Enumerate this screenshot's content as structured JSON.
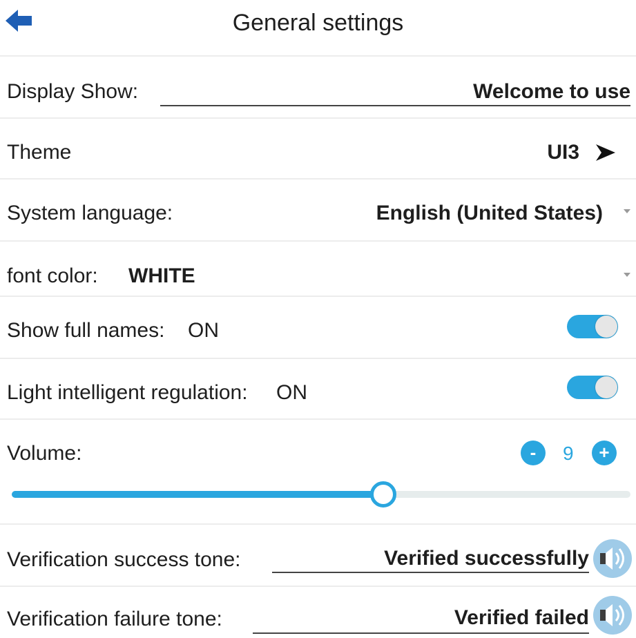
{
  "header": {
    "title": "General settings",
    "back_icon": "arrow-left-icon"
  },
  "display_show": {
    "label": "Display Show:",
    "value": "Welcome to use"
  },
  "theme": {
    "label": "Theme",
    "value": "UI3",
    "icon": "arrow-right-icon"
  },
  "system_language": {
    "label": "System language:",
    "value": "English (United States)"
  },
  "font_color": {
    "label": "font color:",
    "value": "WHITE"
  },
  "show_full_names": {
    "label": "Show full names:",
    "state": "ON",
    "enabled": true
  },
  "light_regulation": {
    "label": "Light intelligent regulation:",
    "state": "ON",
    "enabled": true
  },
  "volume": {
    "label": "Volume:",
    "minus": "-",
    "plus": "+",
    "value": "9",
    "level_fraction": 0.6
  },
  "success_tone": {
    "label": "Verification success tone:",
    "value": "Verified successfully",
    "icon": "speaker-icon"
  },
  "failure_tone": {
    "label": "Verification failure tone:",
    "value": "Verified failed",
    "icon": "speaker-icon"
  },
  "colors": {
    "accent": "#2aa6df",
    "back_arrow": "#1f5fb5",
    "text": "#1e1e1e",
    "divider": "#ececec"
  }
}
